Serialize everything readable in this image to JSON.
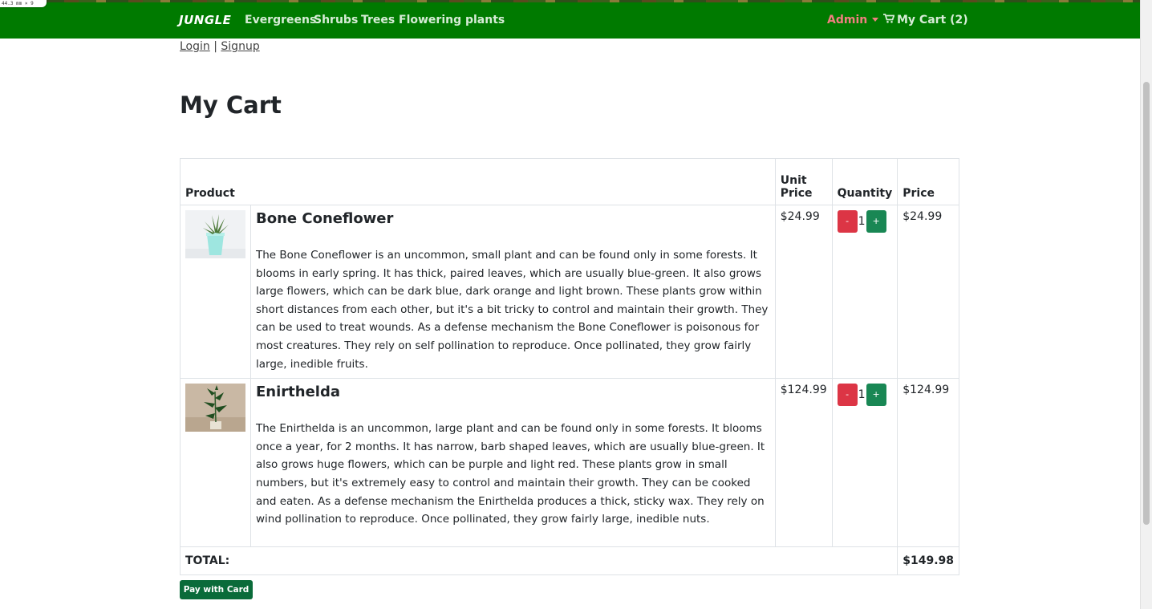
{
  "ruler_label": "44.3 mm × 9",
  "navbar": {
    "brand": "JUNGLE",
    "links": [
      "Evergreens",
      "Shrubs",
      "Trees",
      "Flowering plants"
    ],
    "admin": "Admin",
    "cart": "My Cart (2)"
  },
  "auth": {
    "login": "Login",
    "sep": "|",
    "signup": "Signup"
  },
  "page_title": "My Cart",
  "table": {
    "headers": {
      "product": "Product",
      "unit_price": "Unit Price",
      "quantity": "Quantity",
      "price": "Price"
    },
    "rows": [
      {
        "name": "Bone Coneflower",
        "description": "The Bone Coneflower is an uncommon, small plant and can be found only in some forests. It blooms in early spring. It has thick, paired leaves, which are usually blue-green. It also grows large flowers, which can be dark blue, dark orange and light brown. These plants grow within short distances from each other, but it's a bit tricky to control and maintain their growth. They can be used to treat wounds. As a defense mechanism the Bone Coneflower is poisonous for most creatures. They rely on self pollination to reproduce. Once pollinated, they grow fairly large, inedible fruits.",
        "unit_price": "$24.99",
        "quantity": "1",
        "price": "$24.99"
      },
      {
        "name": "Enirthelda",
        "description": "The Enirthelda is an uncommon, large plant and can be found only in some forests. It blooms once a year, for 2 months. It has narrow, barb shaped leaves, which are usually blue-green. It also grows huge flowers, which can be purple and light red. These plants grow in small numbers, but it's extremely easy to control and maintain their growth. They can be cooked and eaten. As a defense mechanism the Enirthelda produces a thick, sticky wax. They rely on wind pollination to reproduce. Once pollinated, they grow fairly large, inedible nuts.",
        "unit_price": "$124.99",
        "quantity": "1",
        "price": "$124.99"
      }
    ],
    "minus_label": "-",
    "plus_label": "+",
    "total_label": "TOTAL:",
    "total_value": "$149.98"
  },
  "pay_button": "Pay with Card",
  "colors": {
    "navbar": "#007a00",
    "admin": "#f08080",
    "minus": "#dc3545",
    "plus": "#198754",
    "pay": "#0a6b3a"
  }
}
